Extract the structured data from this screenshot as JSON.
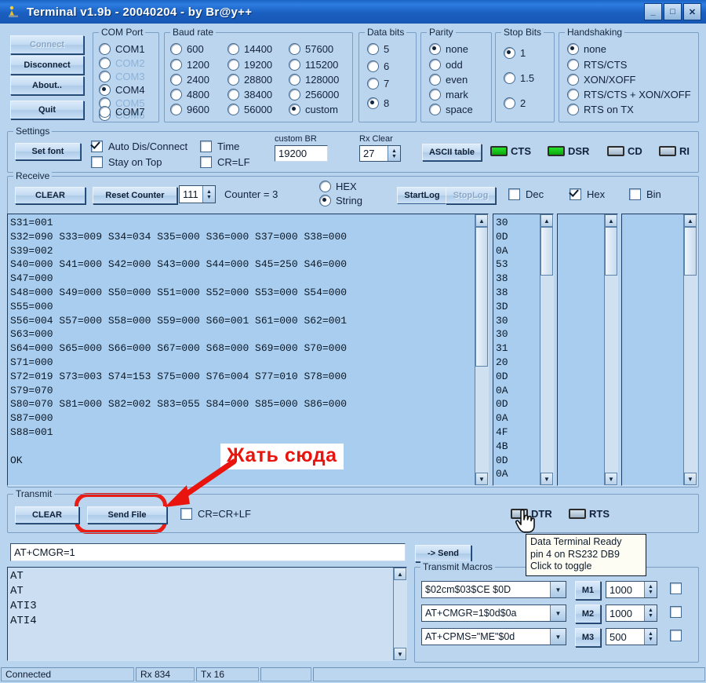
{
  "window": {
    "title": "Terminal v1.9b - 20040204 - by Br@y++",
    "icon": "terminal-app-icon",
    "minimize": "_",
    "maximize": "□",
    "close": "✕"
  },
  "connection_buttons": {
    "connect": "Connect",
    "disconnect": "Disconnect",
    "about": "About..",
    "quit": "Quit"
  },
  "com_port": {
    "title": "COM Port",
    "selected": "COM4",
    "options": [
      {
        "label": "COM1",
        "checked": false,
        "disabled": false
      },
      {
        "label": "COM2",
        "checked": false,
        "disabled": true
      },
      {
        "label": "COM3",
        "checked": false,
        "disabled": true
      },
      {
        "label": "COM4",
        "checked": true,
        "disabled": false
      },
      {
        "label": "COM5",
        "checked": false,
        "disabled": true
      },
      {
        "label": "COM6",
        "checked": false,
        "disabled": true
      },
      {
        "label": "COM7",
        "checked": false,
        "disabled": false
      }
    ]
  },
  "baud_rate": {
    "title": "Baud rate",
    "selected": "custom",
    "col1": [
      {
        "label": "600",
        "checked": false
      },
      {
        "label": "1200",
        "checked": false
      },
      {
        "label": "2400",
        "checked": false
      },
      {
        "label": "4800",
        "checked": false
      },
      {
        "label": "9600",
        "checked": false
      }
    ],
    "col2": [
      {
        "label": "14400",
        "checked": false
      },
      {
        "label": "19200",
        "checked": false
      },
      {
        "label": "28800",
        "checked": false
      },
      {
        "label": "38400",
        "checked": false
      },
      {
        "label": "56000",
        "checked": false
      }
    ],
    "col3": [
      {
        "label": "57600",
        "checked": false
      },
      {
        "label": "115200",
        "checked": false
      },
      {
        "label": "128000",
        "checked": false
      },
      {
        "label": "256000",
        "checked": false
      },
      {
        "label": "custom",
        "checked": true
      }
    ]
  },
  "data_bits": {
    "title": "Data bits",
    "selected": "8",
    "options": [
      {
        "label": "5",
        "checked": false
      },
      {
        "label": "6",
        "checked": false
      },
      {
        "label": "7",
        "checked": false
      },
      {
        "label": "8",
        "checked": true
      }
    ]
  },
  "parity": {
    "title": "Parity",
    "selected": "none",
    "options": [
      {
        "label": "none",
        "checked": true
      },
      {
        "label": "odd",
        "checked": false
      },
      {
        "label": "even",
        "checked": false
      },
      {
        "label": "mark",
        "checked": false
      },
      {
        "label": "space",
        "checked": false
      }
    ]
  },
  "stop_bits": {
    "title": "Stop Bits",
    "selected": "1",
    "options": [
      {
        "label": "1",
        "checked": true
      },
      {
        "label": "1.5",
        "checked": false
      },
      {
        "label": "2",
        "checked": false
      }
    ]
  },
  "handshaking": {
    "title": "Handshaking",
    "selected": "none",
    "options": [
      {
        "label": "none",
        "checked": true
      },
      {
        "label": "RTS/CTS",
        "checked": false
      },
      {
        "label": "XON/XOFF",
        "checked": false
      },
      {
        "label": "RTS/CTS + XON/XOFF",
        "checked": false
      },
      {
        "label": "RTS on TX",
        "checked": false
      }
    ]
  },
  "settings": {
    "title": "Settings",
    "set_font": "Set font",
    "auto_dis_connect": {
      "label": "Auto Dis/Connect",
      "checked": true
    },
    "stay_on_top": {
      "label": "Stay on Top",
      "checked": false
    },
    "time": {
      "label": "Time",
      "checked": false
    },
    "cr_lf": {
      "label": "CR=LF",
      "checked": false
    },
    "custom_br_label": "custom BR",
    "custom_br_value": "19200",
    "rx_clear_label": "Rx Clear",
    "rx_clear_value": "27",
    "ascii_table": "ASCII table",
    "leds": [
      {
        "label": "CTS",
        "state": "on"
      },
      {
        "label": "DSR",
        "state": "on"
      },
      {
        "label": "CD",
        "state": "off"
      },
      {
        "label": "RI",
        "state": "off"
      }
    ]
  },
  "receive": {
    "title": "Receive",
    "clear": "CLEAR",
    "reset_counter": "Reset Counter",
    "counter_value": "111",
    "counter_label": "Counter = 3",
    "mode": {
      "selected": "String",
      "options": [
        {
          "label": "HEX",
          "checked": false
        },
        {
          "label": "String",
          "checked": true
        }
      ]
    },
    "start_log": "StartLog",
    "stop_log": "StopLog",
    "formats": [
      {
        "label": "Dec",
        "checked": false
      },
      {
        "label": "Hex",
        "checked": true
      },
      {
        "label": "Bin",
        "checked": false
      }
    ],
    "text": "S31=001\nS32=090 S33=009 S34=034 S35=000 S36=000 S37=000 S38=000\nS39=002\nS40=000 S41=000 S42=000 S43=000 S44=000 S45=250 S46=000\nS47=000\nS48=000 S49=000 S50=000 S51=000 S52=000 S53=000 S54=000\nS55=000\nS56=004 S57=000 S58=000 S59=000 S60=001 S61=000 S62=001\nS63=000\nS64=000 S65=000 S66=000 S67=000 S68=000 S69=000 S70=000\nS71=000\nS72=019 S73=003 S74=153 S75=000 S76=004 S77=010 S78=000\nS79=070\nS80=070 S81=000 S82=002 S83=055 S84=000 S85=000 S86=000\nS87=000\nS88=001\n\nOK",
    "hex_text": "30\n0D\n0A\n53\n38\n38\n3D\n30\n30\n31\n20\n0D\n0A\n0D\n0A\n4F\n4B\n0D\n0A",
    "bin_text": ""
  },
  "annotation": {
    "text": "Жать сюда",
    "color": "#e8140d"
  },
  "transmit": {
    "title": "Transmit",
    "clear": "CLEAR",
    "send_file": "Send File",
    "cr_crlf": {
      "label": "CR=CR+LF",
      "checked": false
    },
    "input_value": "AT+CMGR=1",
    "send": "-> Send",
    "dtr": {
      "label": "DTR",
      "state": "off"
    },
    "rts": {
      "label": "RTS",
      "state": "off"
    },
    "tooltip": "Data Terminal Ready\npin 4 on RS232 DB9\nClick to toggle",
    "history": "AT\nAT\nATI3\nATI4"
  },
  "macros": {
    "title": "Transmit Macros",
    "rows": [
      {
        "command": "$02cm$03$CE $0D",
        "button": "M1",
        "interval": "1000",
        "repeat": false
      },
      {
        "command": "AT+CMGR=1$0d$0a",
        "button": "M2",
        "interval": "1000",
        "repeat": false
      },
      {
        "command": "AT+CPMS=\"ME\"$0d",
        "button": "M3",
        "interval": "500",
        "repeat": false
      }
    ]
  },
  "statusbar": {
    "connection": "Connected",
    "rx": "Rx 834",
    "tx": "Tx 16",
    "cell4": "",
    "cell5": ""
  }
}
